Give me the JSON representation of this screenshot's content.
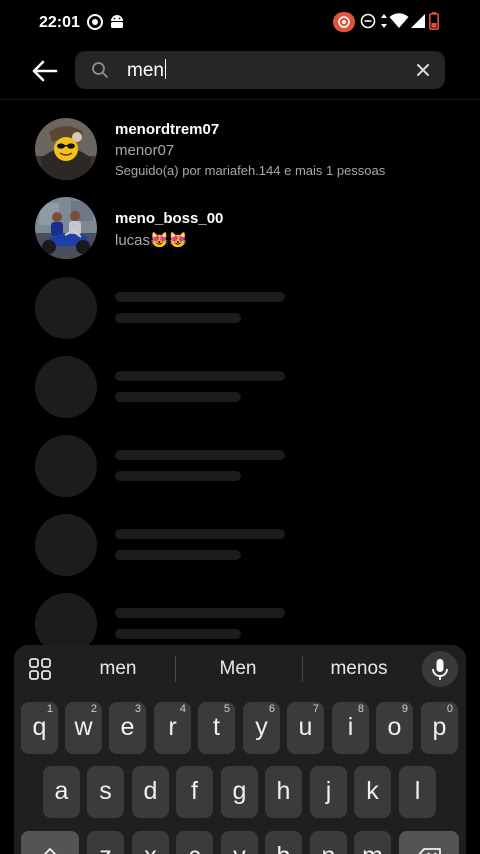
{
  "status_bar": {
    "time": "22:01"
  },
  "search": {
    "query": "men"
  },
  "results": [
    {
      "username": "menordtrem07",
      "full_name": "menor07",
      "followed_by": "Seguido(a) por mariafeh.144 e mais 1 pessoas"
    },
    {
      "username": "meno_boss_00",
      "full_name": "lucas😻😻"
    }
  ],
  "keyboard": {
    "suggestions": [
      "men",
      "Men",
      "menos"
    ],
    "row1": [
      "q",
      "w",
      "e",
      "r",
      "t",
      "y",
      "u",
      "i",
      "o",
      "p"
    ],
    "row1_hints": [
      "1",
      "2",
      "3",
      "4",
      "5",
      "6",
      "7",
      "8",
      "9",
      "0"
    ],
    "row2": [
      "a",
      "s",
      "d",
      "f",
      "g",
      "h",
      "j",
      "k",
      "l"
    ],
    "row3": [
      "z",
      "x",
      "c",
      "v",
      "b",
      "n",
      "m"
    ]
  },
  "colors": {
    "background": "#000000",
    "search_field": "#262626",
    "secondary_text": "#a8a8a8",
    "skeleton": "#1c1c1c",
    "keyboard": "#1f1f1f",
    "key": "#3b3b3b"
  }
}
